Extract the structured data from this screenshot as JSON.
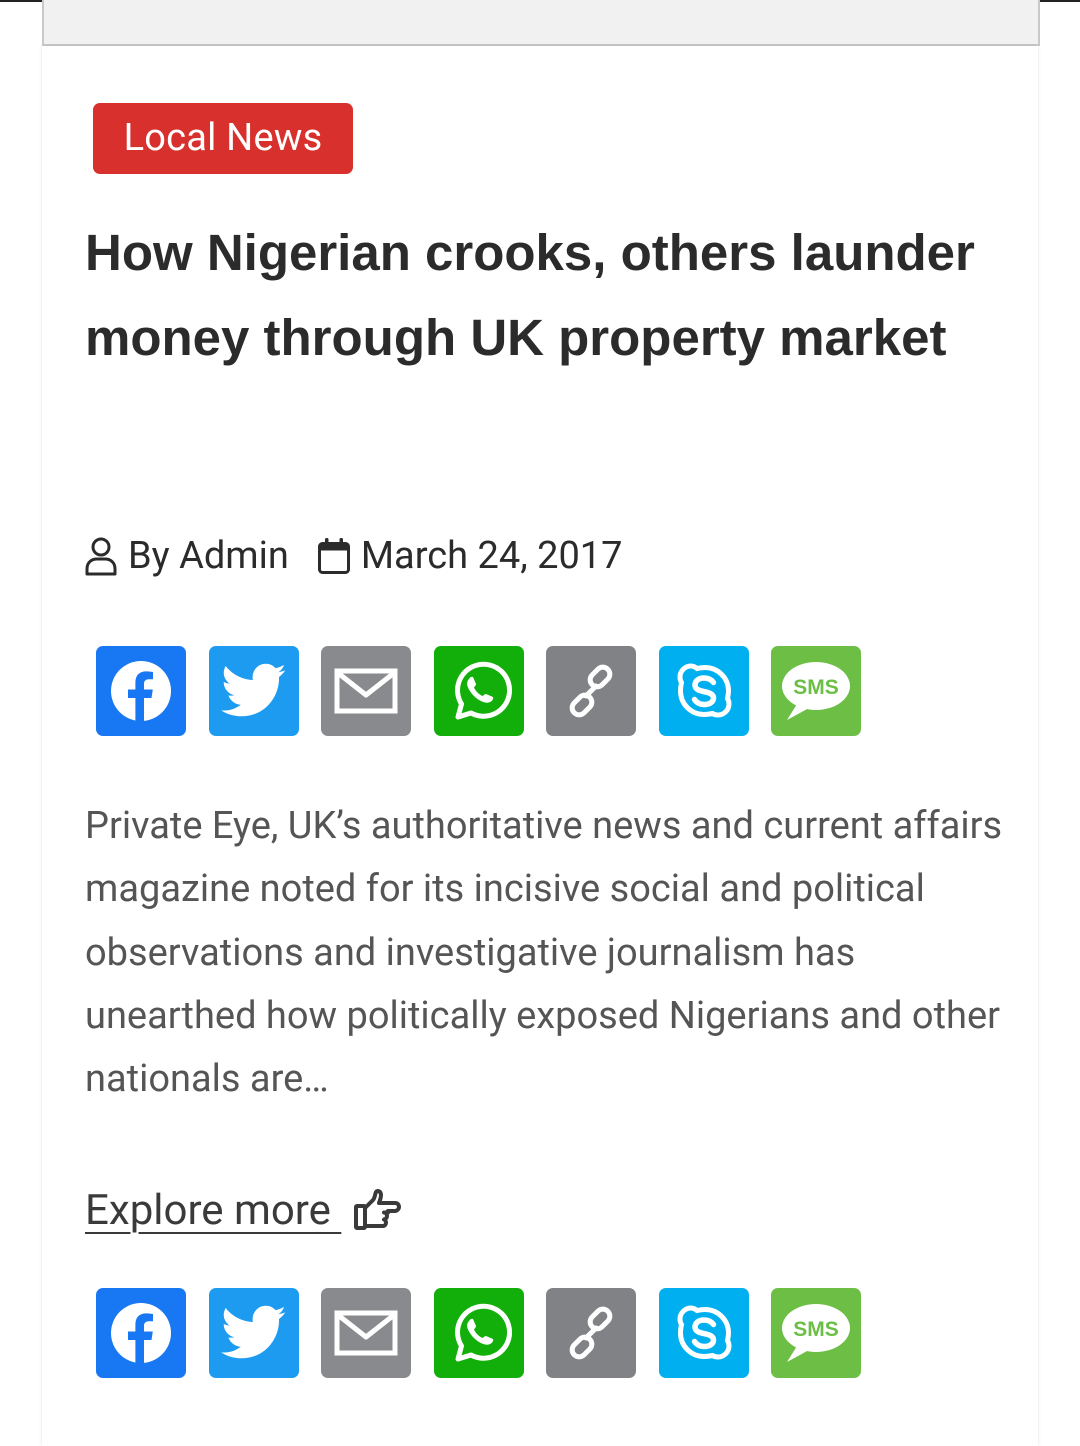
{
  "article": {
    "category": "Local News",
    "title": "How Nigerian crooks, others launder money through UK property market",
    "author": "By Admin",
    "date": "March 24, 2017",
    "excerpt": "Private Eye, UK’s authoritative news and current affairs magazine noted for its incisive social and political observations and investigative journalism has unearthed how politically exposed Nigerians and other nationals are…",
    "explore_label": "Explore more "
  },
  "share": {
    "buttons": [
      {
        "name": "facebook",
        "icon": "facebook-icon",
        "color": "#1877f2"
      },
      {
        "name": "twitter",
        "icon": "twitter-icon",
        "color": "#1d9bf0"
      },
      {
        "name": "email",
        "icon": "email-icon",
        "color": "#888a8e"
      },
      {
        "name": "whatsapp",
        "icon": "whatsapp-icon",
        "color": "#12af0a"
      },
      {
        "name": "copy-link",
        "icon": "link-icon",
        "color": "#808286"
      },
      {
        "name": "skype",
        "icon": "skype-icon",
        "color": "#00aff0"
      },
      {
        "name": "sms",
        "icon": "sms-icon",
        "color": "#6cbe45",
        "label": "SMS"
      }
    ]
  },
  "colors": {
    "badge": "#d8302c",
    "title": "#2b2b2b",
    "body_text": "#555555"
  }
}
